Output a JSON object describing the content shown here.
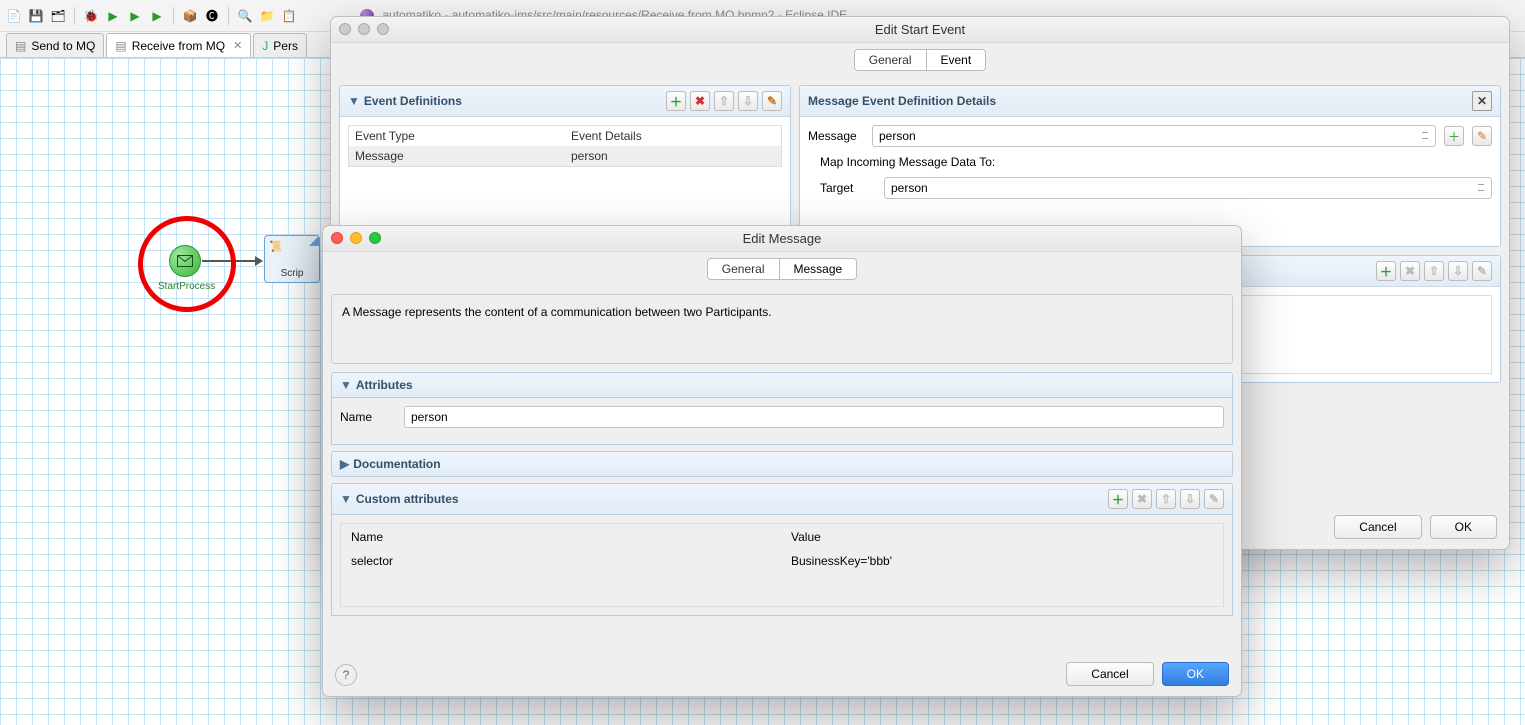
{
  "eclipse_title": "automatiko - automatiko-jms/src/main/resources/Receive from MQ.bpmn2 - Eclipse IDE",
  "file_tabs": [
    {
      "label": "Send to MQ"
    },
    {
      "label": "Receive from MQ",
      "active": true
    },
    {
      "label": "Pers"
    }
  ],
  "start_event_label": "StartProcess",
  "script_task_label": "Scrip",
  "dialog1": {
    "title": "Edit Start Event",
    "tabs": {
      "general": "General",
      "event": "Event"
    },
    "event_definitions": {
      "heading": "Event Definitions",
      "col_type": "Event Type",
      "col_details": "Event Details",
      "row_type": "Message",
      "row_details": "person"
    },
    "message_details": {
      "heading": "Message Event Definition Details",
      "message_label": "Message",
      "message_value": "person",
      "map_label": "Map Incoming Message Data To:",
      "target_label": "Target",
      "target_value": "person"
    },
    "buttons": {
      "cancel": "Cancel",
      "ok": "OK"
    }
  },
  "dialog2": {
    "title": "Edit Message",
    "tabs": {
      "general": "General",
      "message": "Message"
    },
    "description": "A Message represents the content of a communication between two Participants.",
    "sections": {
      "attributes": "Attributes",
      "documentation": "Documentation",
      "custom_attributes": "Custom attributes"
    },
    "name_label": "Name",
    "name_value": "person",
    "custom_table": {
      "col_name": "Name",
      "col_value": "Value",
      "row_name": "selector",
      "row_value": "BusinessKey='bbb'"
    },
    "buttons": {
      "cancel": "Cancel",
      "ok": "OK"
    }
  }
}
